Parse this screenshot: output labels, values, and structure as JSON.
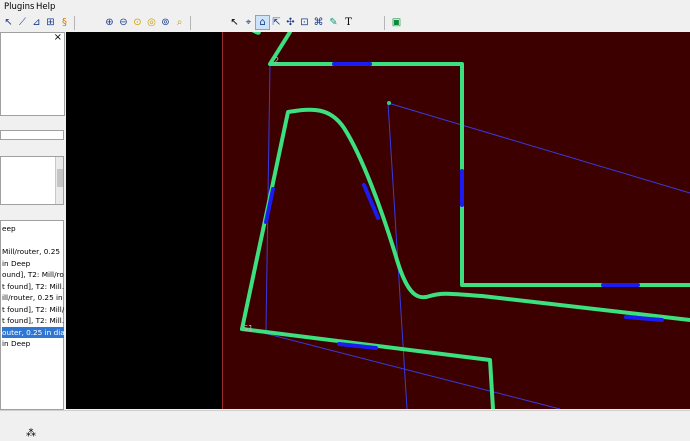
{
  "menu": {
    "items": [
      "Plugins",
      "Help"
    ]
  },
  "toolbar": {
    "groups": [
      [
        "select-arrow-icon",
        "route-tool-icon",
        "measure-tool-icon",
        "bounding-box-icon",
        "script-icon"
      ],
      [
        "zoom-in-icon",
        "zoom-out-icon",
        "zoom-area-icon",
        "zoom-fit-icon",
        "zoom-selection-icon",
        "zoom-extents-icon"
      ],
      [
        "pointer-icon",
        "node-edit-icon",
        "path-edit-icon",
        "align-icon",
        "center-icon",
        "fit-icon",
        "pen-icon",
        "text-tool-icon"
      ],
      [
        "layer-icon"
      ]
    ],
    "active": "path-edit-icon",
    "text_tool_glyph": "T"
  },
  "left_panel": {
    "close_glyph": "×",
    "ops_list": [
      {
        "text": "eep",
        "selected": false
      },
      {
        "text": "Mill/router, 0.25",
        "selected": false
      },
      {
        "text": "in Deep",
        "selected": false
      },
      {
        "text": "ound], T2: Mill/ro...",
        "selected": false
      },
      {
        "text": "t found], T2: Mill...",
        "selected": false
      },
      {
        "text": "ill/router, 0.25 in",
        "selected": false
      },
      {
        "text": "t found], T2: Mill/...",
        "selected": false
      },
      {
        "text": "t found], T2: Mill...",
        "selected": false
      },
      {
        "text": "outer, 0.25 in dia...",
        "selected": true
      },
      {
        "text": "in Deep",
        "selected": false
      }
    ]
  },
  "canvas": {
    "background": "#3d0000",
    "toolpath_color": "#3de07e",
    "tab_color": "#1c1cf0",
    "guide_color": "#3a3adf",
    "labels": {
      "start_top": "2",
      "start_bottom": "S1"
    }
  },
  "statusbar": {
    "icon": "footprints-icon"
  }
}
